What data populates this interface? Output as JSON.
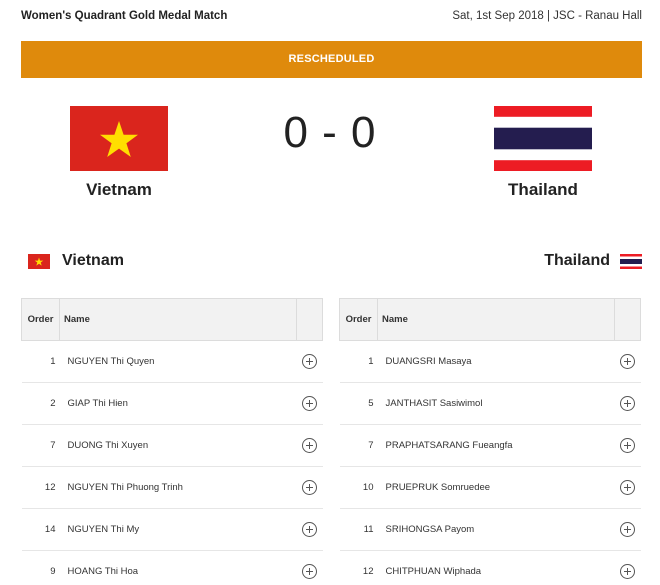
{
  "header": {
    "title": "Women's Quadrant Gold Medal Match",
    "meta": "Sat, 1st Sep 2018 | JSC - Ranau Hall"
  },
  "banner": {
    "status": "RESCHEDULED",
    "color": "#df8a0c"
  },
  "match": {
    "score": "0 - 0",
    "home": {
      "name": "Vietnam",
      "flag": "vietnam-flag"
    },
    "away": {
      "name": "Thailand",
      "flag": "thailand-flag"
    }
  },
  "roster_columns": {
    "order": "Order",
    "name": "Name"
  },
  "home_roster": {
    "team": "Vietnam",
    "rows": [
      {
        "order": "1",
        "name": "NGUYEN Thi Quyen"
      },
      {
        "order": "2",
        "name": "GIAP Thi Hien"
      },
      {
        "order": "7",
        "name": "DUONG Thi Xuyen"
      },
      {
        "order": "12",
        "name": "NGUYEN Thi Phuong Trinh"
      },
      {
        "order": "14",
        "name": "NGUYEN Thi My"
      },
      {
        "order": "9",
        "name": "HOANG Thi Hoa"
      }
    ]
  },
  "away_roster": {
    "team": "Thailand",
    "rows": [
      {
        "order": "1",
        "name": "DUANGSRI Masaya"
      },
      {
        "order": "5",
        "name": "JANTHASIT Sasiwimol"
      },
      {
        "order": "7",
        "name": "PRAPHATSARANG Fueangfa"
      },
      {
        "order": "10",
        "name": "PRUEPRUK Somruedee"
      },
      {
        "order": "11",
        "name": "SRIHONGSA Payom"
      },
      {
        "order": "12",
        "name": "CHITPHUAN Wiphada"
      }
    ]
  },
  "colors": {
    "vietnam_red": "#da251d",
    "vietnam_star": "#ffde00",
    "thailand_red": "#ed1c24",
    "thailand_blue": "#241d4f"
  }
}
